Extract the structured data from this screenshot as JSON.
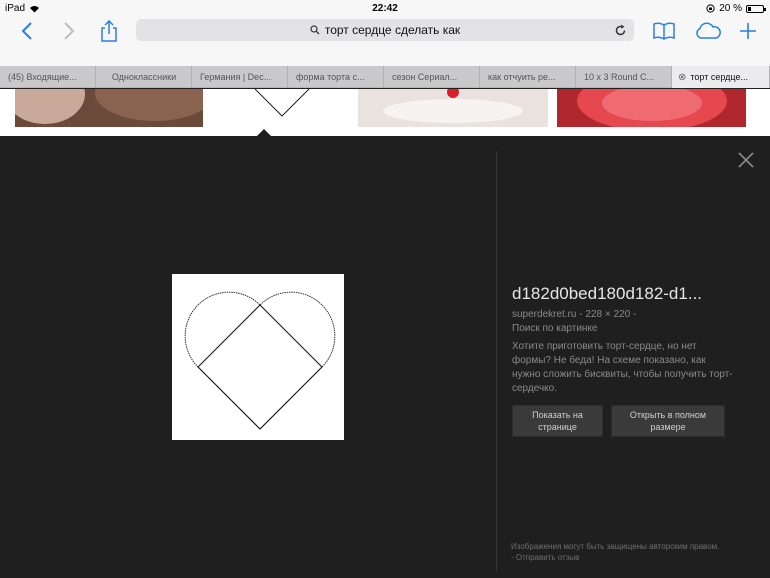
{
  "status": {
    "device": "iPad",
    "time": "22:42",
    "battery": "20 %",
    "battery_level": 0.2
  },
  "toolbar": {
    "address": "торт сердце сделать как"
  },
  "tabs": [
    "(45) Входящие...",
    "Одноклассники",
    "Германия | Dec...",
    "форма торта с...",
    "сезон Сериал...",
    "как отчуить ре...",
    "10 x 3 Round C...",
    "торт сердце..."
  ],
  "viewer": {
    "title": "d182d0bed180d182-d1...",
    "source": "superdekret.ru",
    "dimensions": "228 × 220",
    "separator": "-",
    "search_label": "Поиск по картинке",
    "description": "Хотите приготовить торт-сердце, но нет формы? Не беда! На схеме показано, как нужно сложить бисквиты, чтобы получить торт-сердечко.",
    "btn_show": "Показать на странице",
    "btn_open": "Открыть в полном размере",
    "footer_text": "Изображения могут быть защищены авторским правом.",
    "footer_link": "Отправить отзыв"
  },
  "colors": {
    "accent": "#2b7fe0",
    "viewer_bg": "#1f1f1f"
  }
}
